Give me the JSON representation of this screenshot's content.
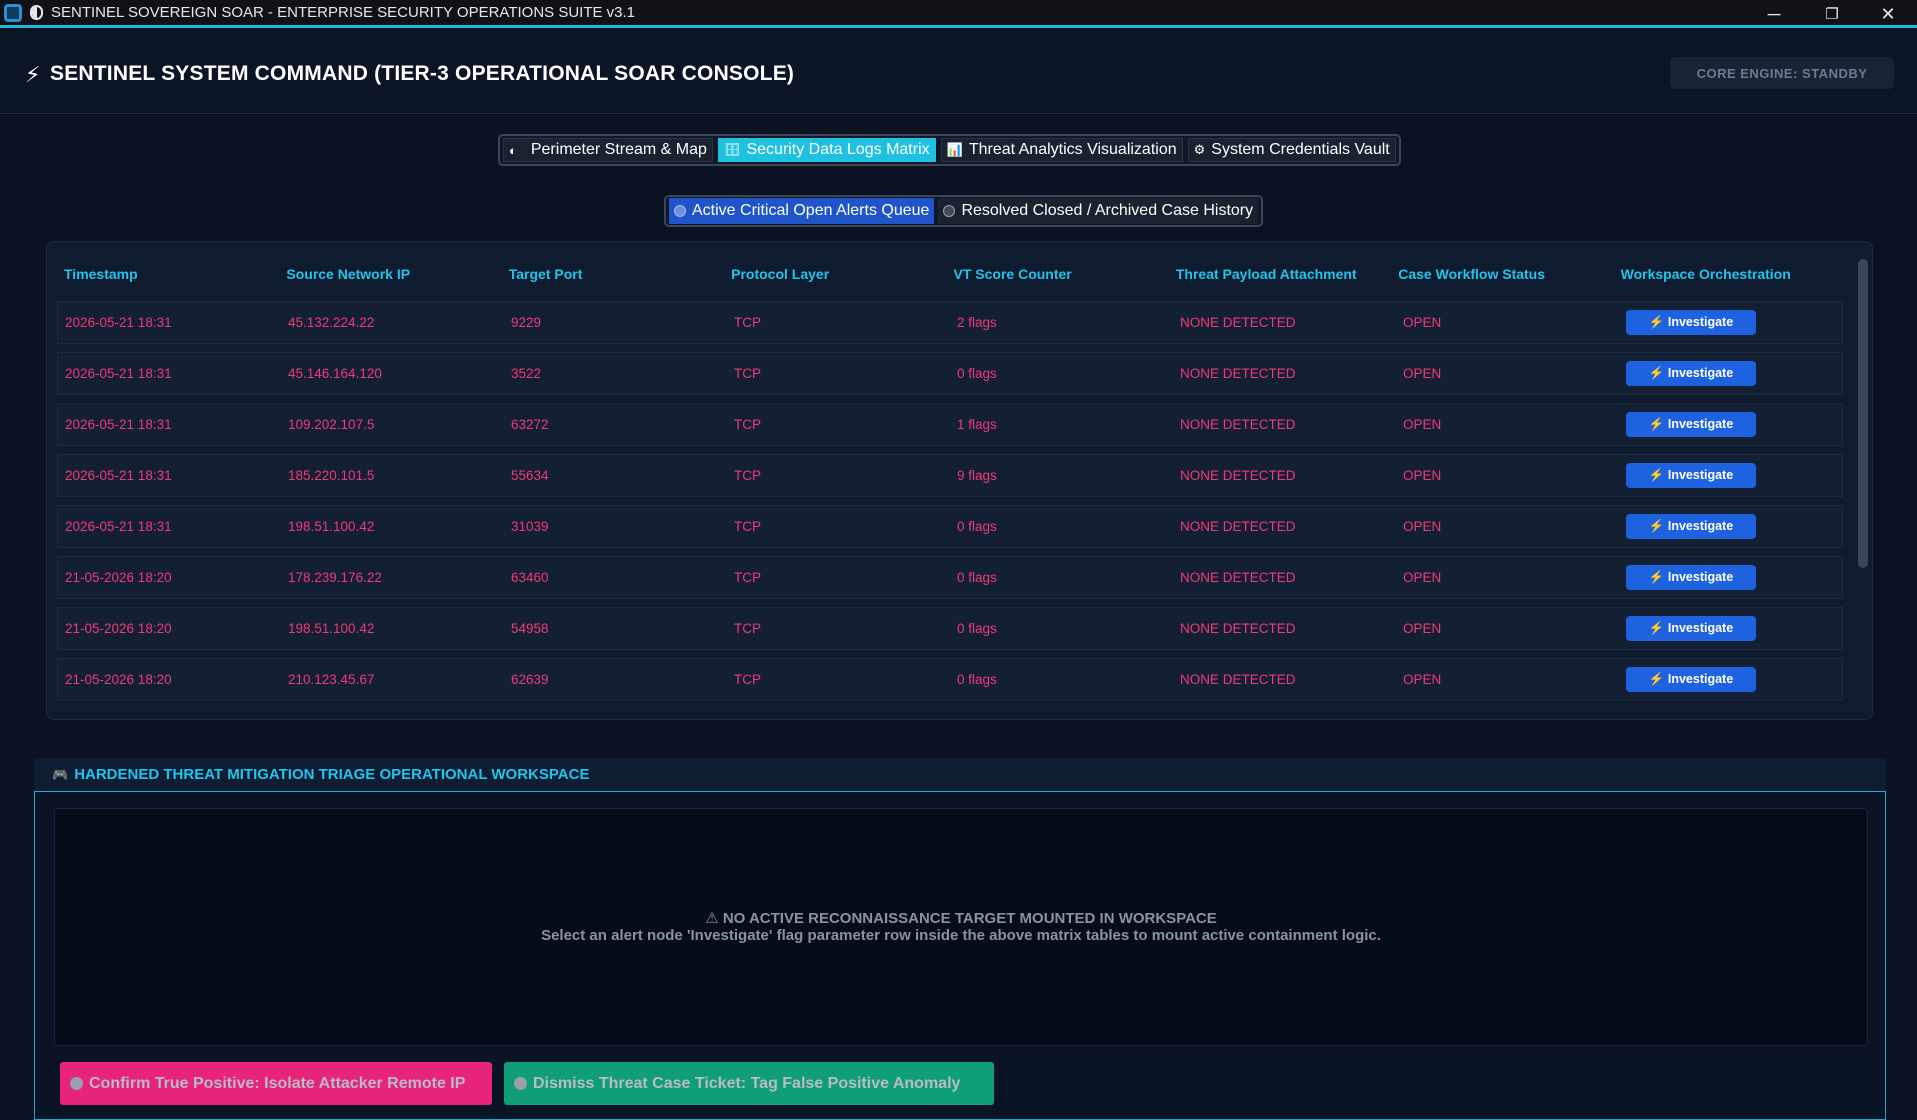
{
  "window": {
    "title": "SENTINEL SOVEREIGN SOAR - ENTERPRISE SECURITY OPERATIONS SUITE v3.1",
    "minimize": "─",
    "restore": "❐",
    "close": "✕"
  },
  "header": {
    "icon": "⚡",
    "title": "SENTINEL SYSTEM COMMAND (TIER-3 OPERATIONAL SOAR CONSOLE)",
    "engine_status": "CORE ENGINE: STANDBY"
  },
  "tabs": [
    {
      "icon": "◐",
      "label": "Perimeter Stream & Map",
      "active": false
    },
    {
      "icon": "🗄",
      "label": "Security Data Logs Matrix",
      "active": true
    },
    {
      "icon": "📊",
      "label": "Threat Analytics Visualization",
      "active": false
    },
    {
      "icon": "⚙",
      "label": "System Credentials Vault",
      "active": false
    }
  ],
  "subtabs": [
    {
      "label": "Active Critical Open Alerts Queue",
      "active": true
    },
    {
      "label": "Resolved Closed / Archived Case History",
      "active": false
    }
  ],
  "table": {
    "columns": [
      "Timestamp",
      "Source Network IP",
      "Target Port",
      "Protocol Layer",
      "VT Score Counter",
      "Threat Payload Attachment",
      "Case Workflow Status",
      "Workspace Orchestration"
    ],
    "action_label": "⚡ Investigate",
    "rows": [
      [
        "2026-05-21 18:31",
        "45.132.224.22",
        "9229",
        "TCP",
        "2 flags",
        "NONE DETECTED",
        "OPEN"
      ],
      [
        "2026-05-21 18:31",
        "45.146.164.120",
        "3522",
        "TCP",
        "0 flags",
        "NONE DETECTED",
        "OPEN"
      ],
      [
        "2026-05-21 18:31",
        "109.202.107.5",
        "63272",
        "TCP",
        "1 flags",
        "NONE DETECTED",
        "OPEN"
      ],
      [
        "2026-05-21 18:31",
        "185.220.101.5",
        "55634",
        "TCP",
        "9 flags",
        "NONE DETECTED",
        "OPEN"
      ],
      [
        "2026-05-21 18:31",
        "198.51.100.42",
        "31039",
        "TCP",
        "0 flags",
        "NONE DETECTED",
        "OPEN"
      ],
      [
        "21-05-2026 18:20",
        "178.239.176.22",
        "63460",
        "TCP",
        "0 flags",
        "NONE DETECTED",
        "OPEN"
      ],
      [
        "21-05-2026 18:20",
        "198.51.100.42",
        "54958",
        "TCP",
        "0 flags",
        "NONE DETECTED",
        "OPEN"
      ],
      [
        "21-05-2026 18:20",
        "210.123.45.67",
        "62639",
        "TCP",
        "0 flags",
        "NONE DETECTED",
        "OPEN"
      ]
    ]
  },
  "workspace": {
    "icon": "🎮",
    "title": "HARDENED THREAT MITIGATION TRIAGE OPERATIONAL WORKSPACE",
    "empty_title": "⚠ NO ACTIVE RECONNAISSANCE TARGET MOUNTED IN WORKSPACE",
    "empty_subtitle": "Select an alert node 'Investigate' flag parameter row inside the above matrix tables to mount active containment logic.",
    "confirm_label": "Confirm True Positive: Isolate Attacker Remote IP",
    "dismiss_label": "Dismiss Threat Case Ticket: Tag False Positive Anomaly"
  },
  "colors": {
    "accent_cyan": "#21c4ec",
    "alert_pink": "#f0397a",
    "button_blue": "#1e62e0",
    "confirm_pink": "#e7237a",
    "dismiss_green": "#0f9e78"
  }
}
